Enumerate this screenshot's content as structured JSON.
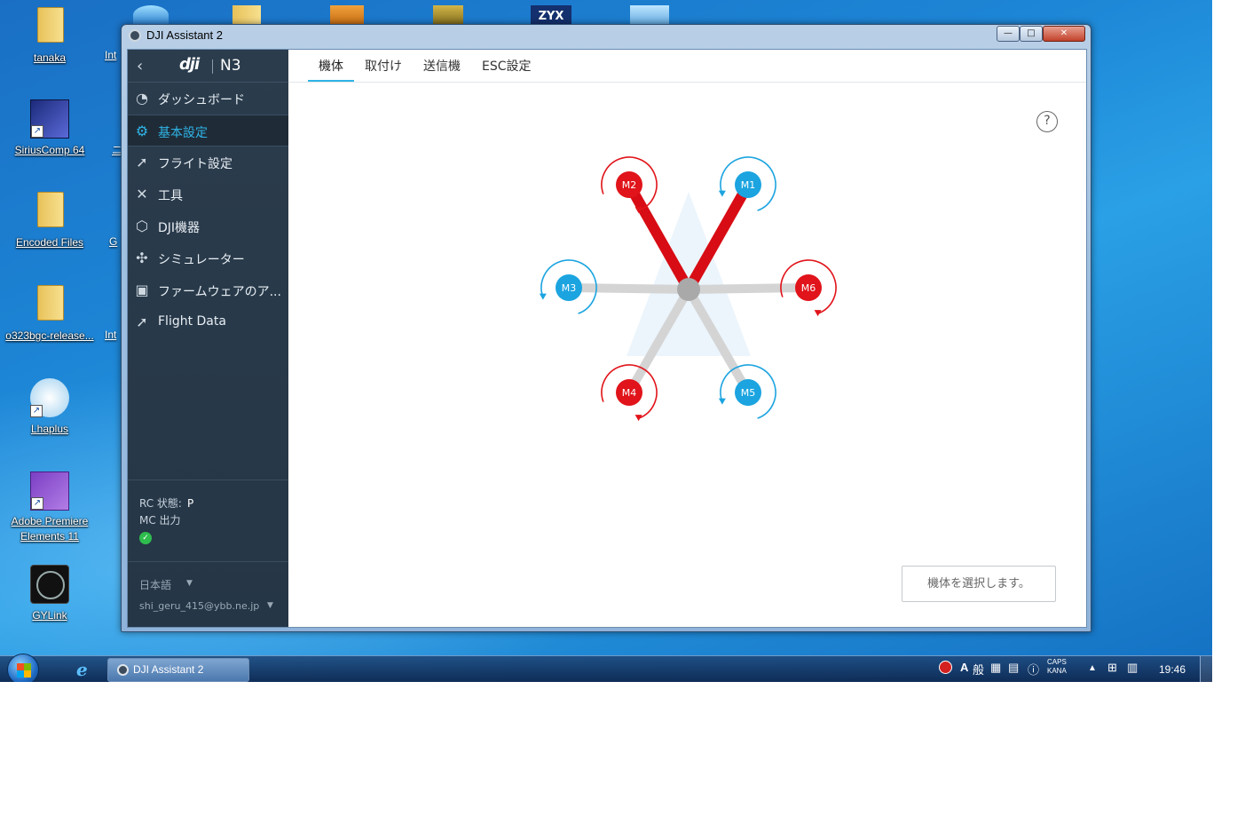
{
  "desktop": {
    "icons": [
      {
        "label": "tanaka"
      },
      {
        "label": "SiriusComp 64"
      },
      {
        "label": "Encoded Files"
      },
      {
        "label": "o323bgc-release..."
      },
      {
        "label": "Lhaplus"
      },
      {
        "label": "Adobe Premiere Elements 11"
      },
      {
        "label": "GYLink"
      }
    ],
    "peek_labels": [
      "Int",
      "ニ",
      "G",
      "Int"
    ],
    "top_icon_text": "ZYX"
  },
  "window": {
    "title": "DJI Assistant 2",
    "buttons": {
      "minimize": "—",
      "maximize": "□",
      "close": "✕"
    }
  },
  "sidebar": {
    "brand": "dji",
    "model": "N3",
    "items": [
      {
        "label": "ダッシュボード",
        "icon": "gauge-icon",
        "active": false
      },
      {
        "label": "基本設定",
        "icon": "gear-icon",
        "active": true
      },
      {
        "label": "フライト設定",
        "icon": "rocket-icon",
        "active": false
      },
      {
        "label": "工具",
        "icon": "tools-icon",
        "active": false
      },
      {
        "label": "DJI機器",
        "icon": "cube-icon",
        "active": false
      },
      {
        "label": "シミュレーター",
        "icon": "drone-icon",
        "active": false
      },
      {
        "label": "ファームウェアのア...",
        "icon": "firmware-icon",
        "active": false
      },
      {
        "label": "Flight Data",
        "icon": "rocket-icon",
        "active": false
      }
    ],
    "status": {
      "rc_label": "RC 状態:",
      "rc_value": "P",
      "mc_label": "MC 出力",
      "mc_ok": true
    },
    "language": "日本語",
    "account": "shi_geru_415@ybb.ne.jp"
  },
  "tabs": [
    {
      "label": "機体",
      "active": true
    },
    {
      "label": "取付け",
      "active": false
    },
    {
      "label": "送信機",
      "active": false
    },
    {
      "label": "ESC設定",
      "active": false
    }
  ],
  "motors": [
    {
      "id": "M1",
      "color": "#1ba4e0",
      "rotation": "ccw"
    },
    {
      "id": "M2",
      "color": "#e0141a",
      "rotation": "cw"
    },
    {
      "id": "M3",
      "color": "#1ba4e0",
      "rotation": "ccw"
    },
    {
      "id": "M4",
      "color": "#e0141a",
      "rotation": "cw"
    },
    {
      "id": "M5",
      "color": "#1ba4e0",
      "rotation": "ccw"
    },
    {
      "id": "M6",
      "color": "#e0141a",
      "rotation": "cw"
    }
  ],
  "select_button": "機体を選択します。",
  "help_icon": "?",
  "taskbar": {
    "task_label": "DJI Assistant 2",
    "tray": {
      "ime_a": "A",
      "ime_mode": "般",
      "caps": "CAPS",
      "kana": "KANA"
    },
    "clock": "19:46"
  },
  "colors": {
    "accent": "#2fb4e6",
    "cw": "#e0141a",
    "ccw": "#1ba4e0",
    "sidebar": "#2b3c4d"
  }
}
